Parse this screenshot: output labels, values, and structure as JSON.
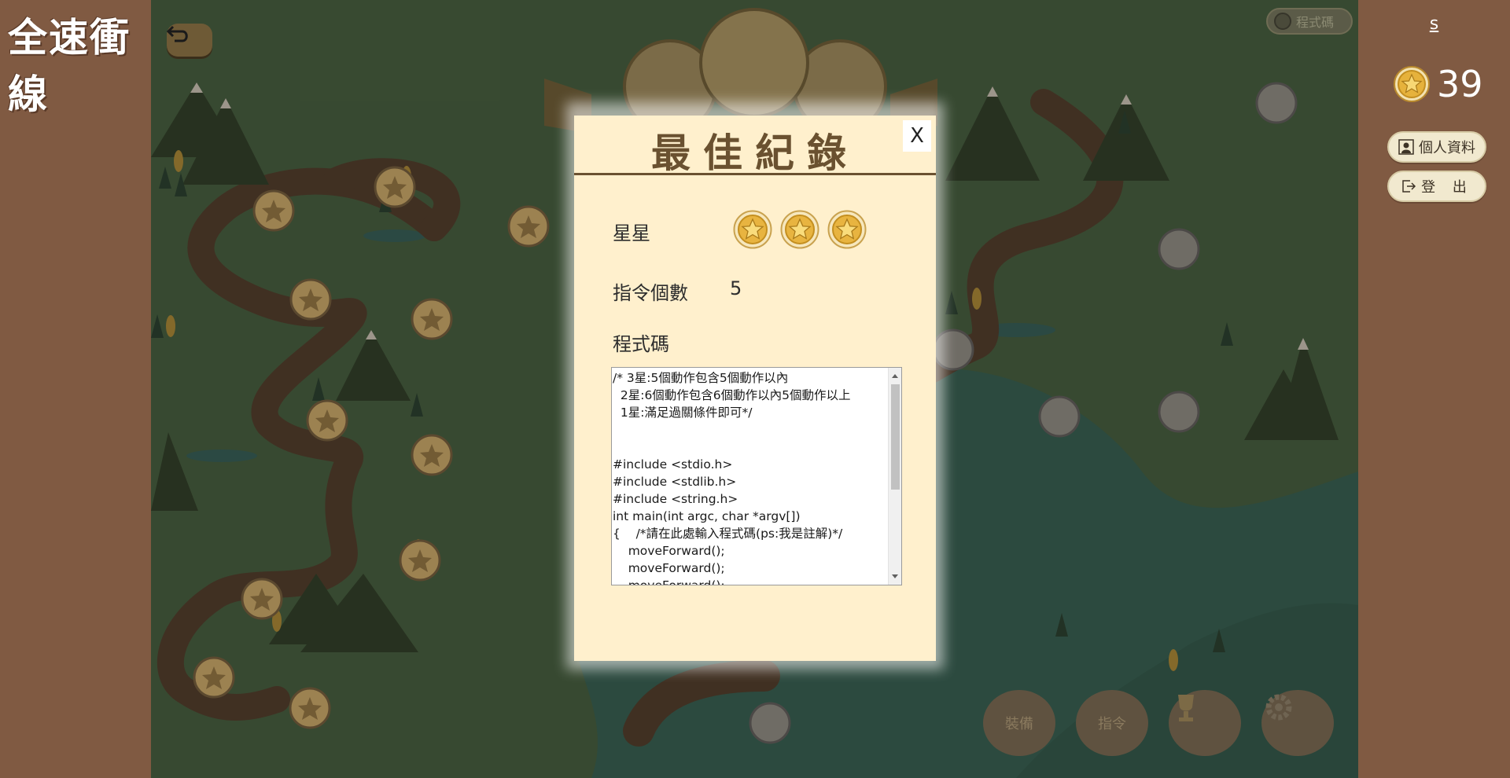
{
  "app": {
    "logo": "全速衝線"
  },
  "user": {
    "name": "s",
    "coins": "39"
  },
  "sidebar": {
    "profile_label": "個人資料",
    "logout_label": "登 出"
  },
  "topbar": {
    "code_toggle_label": "程式碼"
  },
  "bottom_buttons": [
    {
      "label": "裝備",
      "icon": "chest-icon"
    },
    {
      "label": "指令",
      "icon": "book-icon"
    },
    {
      "label": "",
      "icon": "trophy-icon"
    },
    {
      "label": "",
      "icon": "gear-icon"
    }
  ],
  "modal": {
    "title": "最佳紀錄",
    "close_label": "X",
    "stars_label": "星星",
    "stars_earned": 3,
    "count_label": "指令個數",
    "count_value": "5",
    "code_label": "程式碼",
    "code": "/* 3星:5個動作包含5個動作以內\n  2星:6個動作包含6個動作以內5個動作以上\n  1星:滿足過關條件即可*/\n\n\n#include <stdio.h>\n#include <stdlib.h>\n#include <string.h>\nint main(int argc, char *argv[])\n{    /*請在此處輸入程式碼(ps:我是註解)*/\n    moveForward();\n    moveForward();\n    moveForward();"
  },
  "colors": {
    "brown_panel": "#805a42",
    "modal_bg": "#fff0cd",
    "modal_accent": "#6a5130",
    "coin_gold": "#e6b23c"
  }
}
